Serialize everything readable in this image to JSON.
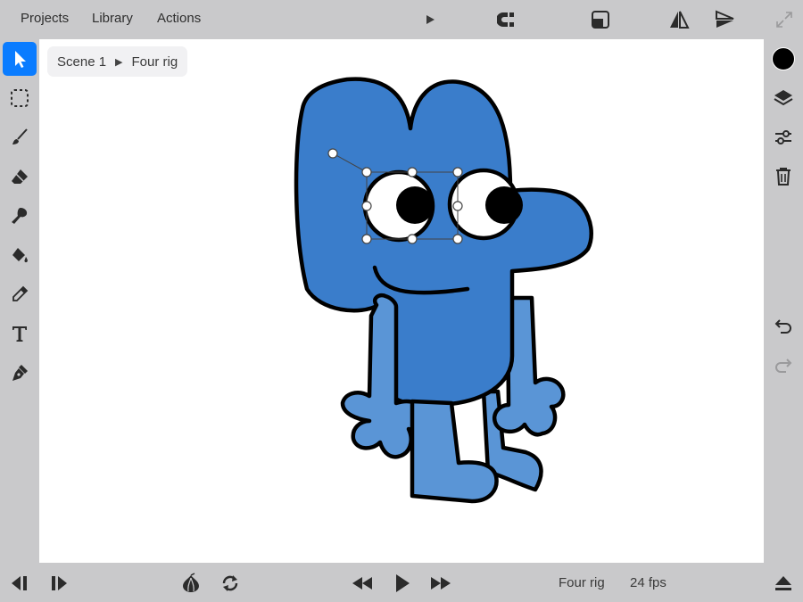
{
  "menu": {
    "projects": "Projects",
    "library": "Library",
    "actions": "Actions"
  },
  "breadcrumb": {
    "scene": "Scene 1",
    "separator": "▶",
    "symbol": "Four rig"
  },
  "bottom": {
    "symbol_name": "Four rig",
    "fps": "24 fps"
  },
  "colors": {
    "accent": "#0a7cff",
    "character_fill": "#3a7dcb",
    "character_light": "#5a95d6",
    "outline": "#000000",
    "current_color": "#000000"
  },
  "icons": {
    "top": [
      "play-icon",
      "onion-skin-icon",
      "frame-icon",
      "flip-horizontal-icon",
      "flip-vertical-icon",
      "expand-icon"
    ],
    "left": [
      "select-icon",
      "marquee-icon",
      "brush-icon",
      "eraser-icon",
      "smudge-icon",
      "fill-icon",
      "eyedropper-icon",
      "text-icon",
      "pen-icon"
    ],
    "right": [
      "color-swatch",
      "layers-icon",
      "adjust-icon",
      "trash-icon",
      "undo-icon",
      "redo-icon"
    ],
    "bottom": [
      "prev-frame-icon",
      "next-frame-icon",
      "onion-icon",
      "loop-icon",
      "rewind-icon",
      "play-icon",
      "fast-forward-icon",
      "eject-icon"
    ]
  }
}
